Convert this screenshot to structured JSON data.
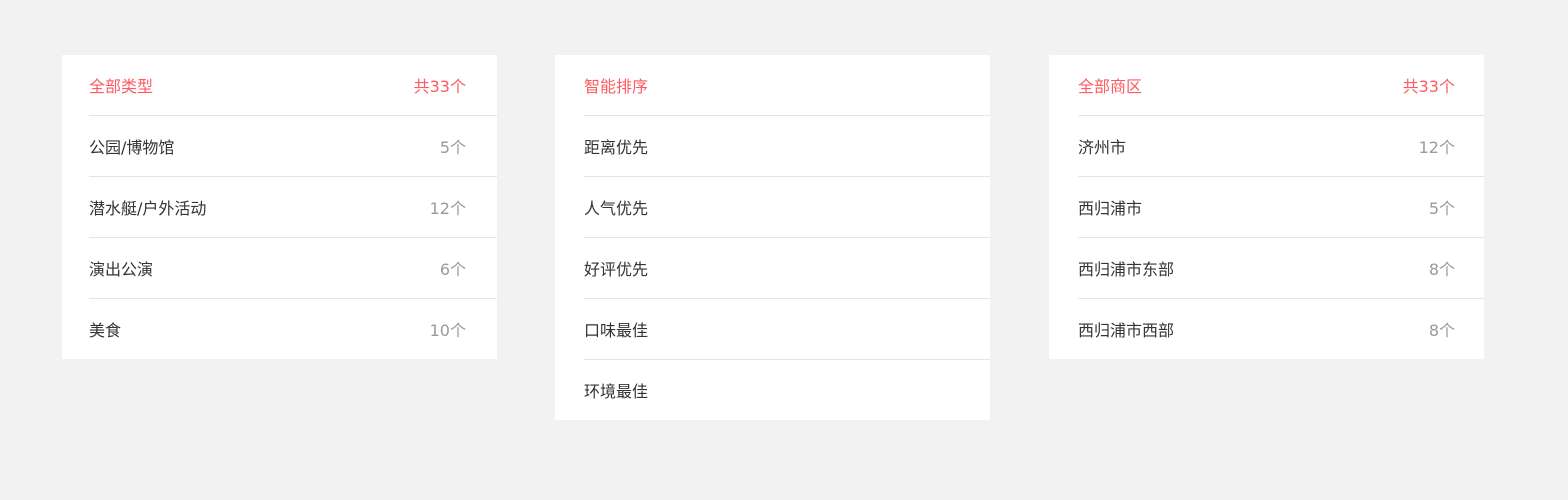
{
  "colors": {
    "accent": "#ff5a5f",
    "text": "#333333",
    "muted": "#9a9a9a",
    "divider": "#e4e4e4",
    "background": "#f2f2f2"
  },
  "type_panel": {
    "header_label": "全部类型",
    "header_count": "共33个",
    "items": [
      {
        "label": "公园/博物馆",
        "count": "5个"
      },
      {
        "label": "潜水艇/户外活动",
        "count": "12个"
      },
      {
        "label": "演出公演",
        "count": "6个"
      },
      {
        "label": "美食",
        "count": "10个"
      }
    ]
  },
  "sort_panel": {
    "header_label": "智能排序",
    "items": [
      {
        "label": "距离优先"
      },
      {
        "label": "人气优先"
      },
      {
        "label": "好评优先"
      },
      {
        "label": "口味最佳"
      },
      {
        "label": "环境最佳"
      }
    ]
  },
  "area_panel": {
    "header_label": "全部商区",
    "header_count": "共33个",
    "items": [
      {
        "label": "济州市",
        "count": "12个"
      },
      {
        "label": "西归浦市",
        "count": "5个"
      },
      {
        "label": "西归浦市东部",
        "count": "8个"
      },
      {
        "label": "西归浦市西部",
        "count": "8个"
      }
    ]
  }
}
